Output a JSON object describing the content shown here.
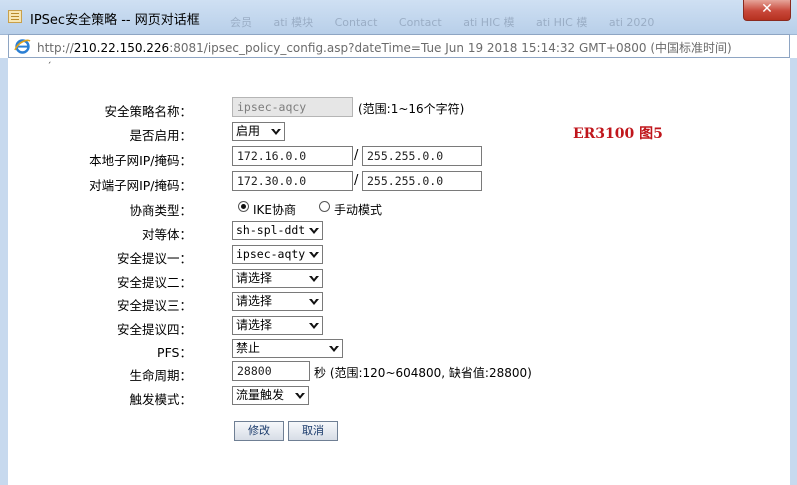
{
  "window": {
    "title": "IPSec安全策略 -- 网页对话框",
    "close_label": "✕",
    "background_tabs": [
      "会员",
      "ati 模块",
      "Contact",
      "Contact",
      "ati HIC 模",
      "ati HIC 模",
      "ati 2020"
    ]
  },
  "address": {
    "url_prefix": "http://",
    "host": "210.22.150.226",
    "path": ":8081/ipsec_policy_config.asp?dateTime=Tue Jun 19 2018 15:14:32 GMT+0800 (中国标准时间)"
  },
  "annotation": "ER3100   图5",
  "form": {
    "policy_name": {
      "label": "安全策略名称：",
      "value": "ipsec-aqcy",
      "hint": "(范围:1~16个字符)"
    },
    "enabled": {
      "label": "是否启用：",
      "value": "启用"
    },
    "local_subnet": {
      "label": "本地子网IP/掩码：",
      "ip": "172.16.0.0",
      "mask": "255.255.0.0"
    },
    "remote_subnet": {
      "label": "对端子网IP/掩码：",
      "ip": "172.30.0.0",
      "mask": "255.255.0.0"
    },
    "negotiation": {
      "label": "协商类型：",
      "option_ike": "IKE协商",
      "option_manual": "手动模式",
      "selected": "IKE协商"
    },
    "peer": {
      "label": "对等体：",
      "value": "sh-spl-ddt"
    },
    "proposal1": {
      "label": "安全提议一：",
      "value": "ipsec-aqty"
    },
    "proposal2": {
      "label": "安全提议二：",
      "value": "请选择"
    },
    "proposal3": {
      "label": "安全提议三：",
      "value": "请选择"
    },
    "proposal4": {
      "label": "安全提议四：",
      "value": "请选择"
    },
    "pfs": {
      "label": "PFS：",
      "value": "禁止"
    },
    "lifetime": {
      "label": "生命周期：",
      "value": "28800",
      "hint": "秒 (范围:120~604800, 缺省值:28800)"
    },
    "trigger": {
      "label": "触发模式：",
      "value": "流量触发"
    },
    "modify_label": "修改",
    "cancel_label": "取消"
  }
}
